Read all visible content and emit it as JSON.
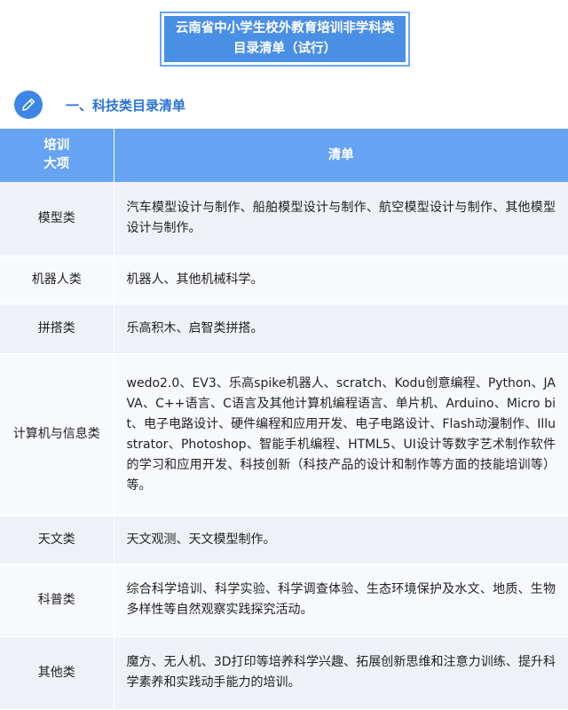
{
  "title": {
    "line1": "云南省中小学生校外教育培训非学科类",
    "line2": "目录清单（试行）"
  },
  "section": {
    "icon": "pencil-icon",
    "title": "一、科技类目录清单"
  },
  "table": {
    "header_category_line1": "培训",
    "header_category_line2": "大项",
    "header_list": "清单",
    "rows": [
      {
        "category": "模型类",
        "items": "汽车模型设计与制作、船舶模型设计与制作、航空模型设计与制作、其他模型设计与制作。"
      },
      {
        "category": "机器人类",
        "items": "机器人、其他机械科学。"
      },
      {
        "category": "拼搭类",
        "items": "乐高积木、启智类拼搭。"
      },
      {
        "category": "计算机与信息类",
        "items": "wedo2.0、EV3、乐高spike机器人、scratch、Kodu创意编程、Python、JAVA、C++语言、C语言及其他计算机编程语言、单片机、Arduino、Micro bit、电子电路设计、硬件编程和应用开发、电子电路设计、Flash动漫制作、Illustrator、Photoshop、智能手机编程、HTML5、UI设计等数字艺术制作软件的学习和应用开发、科技创新（科技产品的设计和制作等方面的技能培训等）等。"
      },
      {
        "category": "天文类",
        "items": "天文观测、天文模型制作。"
      },
      {
        "category": "科普类",
        "items": "综合科学培训、科学实验、科学调查体验、生态环境保护及水文、地质、生物多样性等自然观察实践探究活动。"
      },
      {
        "category": "其他类",
        "items": "魔方、无人机、3D打印等培养科学兴趣、拓展创新思维和注意力训练、提升科学素养和实践动手能力的培训。"
      }
    ]
  },
  "colors": {
    "title_bg": "#4a8fe6",
    "header_bg": "#66a3f2",
    "section_title": "#2a74d8",
    "row_odd": "#eef2f7",
    "row_even": "#f7f9fc"
  }
}
